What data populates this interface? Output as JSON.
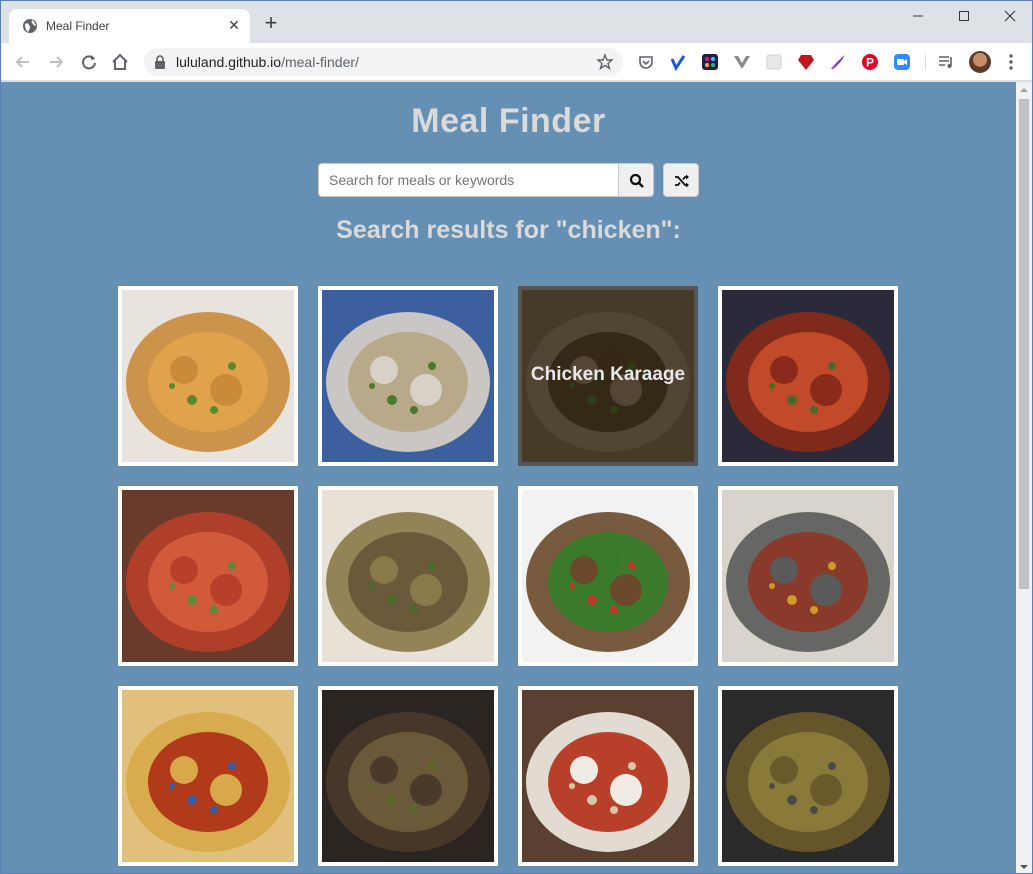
{
  "browser": {
    "tab_title": "Meal Finder",
    "url_host": "lululand.github.io",
    "url_path": "/meal-finder/"
  },
  "page": {
    "title": "Meal Finder",
    "search_placeholder": "Search for meals or keywords",
    "search_value": "",
    "results_heading": "Search results for \"chicken\":"
  },
  "meals": [
    {
      "name": "",
      "icon": "curry-plate-image",
      "palette": [
        "#e8e3dc",
        "#c98a3a",
        "#e0a24a",
        "#5a8a2a"
      ],
      "hovered": false
    },
    {
      "name": "",
      "icon": "congee-bowl-image",
      "palette": [
        "#3c5fa0",
        "#d8d2c6",
        "#b8a98a",
        "#4a7a2a"
      ],
      "hovered": false
    },
    {
      "name": "Chicken Karaage",
      "icon": "karaage-board-image",
      "palette": [
        "#b89a6a",
        "#d9b98a",
        "#8a6a3a",
        "#7aa03a"
      ],
      "hovered": true
    },
    {
      "name": "",
      "icon": "casserole-pan-image",
      "palette": [
        "#2a2a3a",
        "#8a2a1a",
        "#c04a2a",
        "#4a6a2a"
      ],
      "hovered": false
    },
    {
      "name": "",
      "icon": "tandoori-plate-image",
      "palette": [
        "#6a3a2a",
        "#b8402a",
        "#d05a3a",
        "#5a8a3a"
      ],
      "hovered": false
    },
    {
      "name": "",
      "icon": "lentil-plate-image",
      "palette": [
        "#e8e2d6",
        "#8a7a4a",
        "#6a5a3a",
        "#4a6a2a"
      ],
      "hovered": false
    },
    {
      "name": "",
      "icon": "stirfry-bowl-image",
      "palette": [
        "#f2f2f2",
        "#6a4a2a",
        "#3a7a2a",
        "#c03a2a"
      ],
      "hovered": false
    },
    {
      "name": "",
      "icon": "skillet-stew-image",
      "palette": [
        "#d8d4cc",
        "#5a5a5a",
        "#8a3a2a",
        "#d09a2a"
      ],
      "hovered": false
    },
    {
      "name": "",
      "icon": "pie-dish-image",
      "palette": [
        "#e0c07a",
        "#d8a84a",
        "#b03a1a",
        "#3a5aa0"
      ],
      "hovered": false
    },
    {
      "name": "",
      "icon": "braised-bowl-image",
      "palette": [
        "#2a2520",
        "#4a3a2a",
        "#6a5a3a",
        "#5a6a2a"
      ],
      "hovered": false
    },
    {
      "name": "",
      "icon": "rice-curry-image",
      "palette": [
        "#5a4030",
        "#f0ece4",
        "#b8402a",
        "#d8c8a8"
      ],
      "hovered": false
    },
    {
      "name": "",
      "icon": "dutch-oven-image",
      "palette": [
        "#2a2a2a",
        "#6a5a2a",
        "#8a7a3a",
        "#4a4a4a"
      ],
      "hovered": false
    }
  ]
}
